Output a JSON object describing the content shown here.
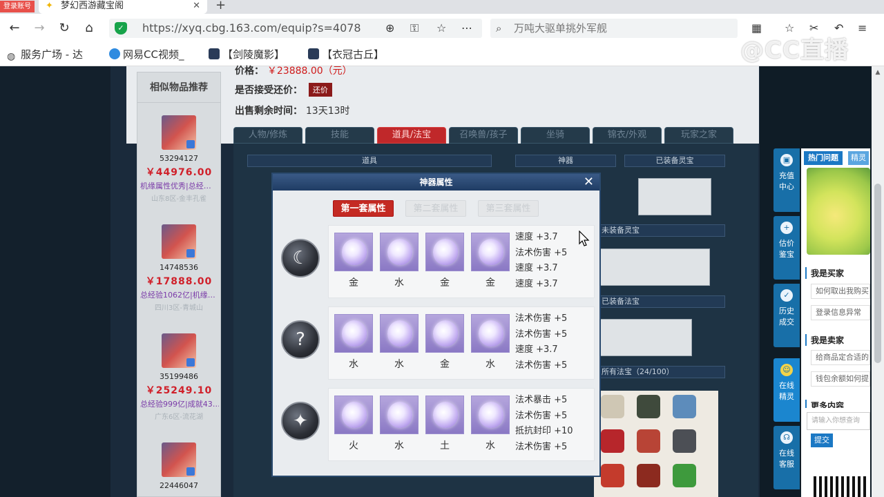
{
  "browser": {
    "login_badge": "登录账号",
    "tab_title": "梦幻西游藏宝阁",
    "tab_close": "✕",
    "new_tab": "+",
    "url": "https://xyq.cbg.163.com/equip?s=4078",
    "search_text": "万吨大驱单挑外军舰",
    "bookmarks": [
      "服务广场 - 达",
      "网易CC视频_",
      "【剑陵魔影】",
      "【衣冠古丘】"
    ]
  },
  "overlay": {
    "brand": "@CC直播"
  },
  "sidebar_left": {
    "title": "相似物品推荐",
    "items": [
      {
        "id": "53294127",
        "price": "￥44976.00",
        "desc": "机缘属性优秀|总经…",
        "server": "山东8区-金丰孔雀"
      },
      {
        "id": "14748536",
        "price": "￥17888.00",
        "desc": "总经验1062亿|机缘…",
        "server": "四川3区-青城山"
      },
      {
        "id": "35199486",
        "price": "￥25249.10",
        "desc": "总经验999亿|成就43…",
        "server": "广东6区-流花湖"
      },
      {
        "id": "22446047",
        "price": "",
        "desc": "",
        "server": ""
      }
    ]
  },
  "info": {
    "price_label": "价格：",
    "price_value": "￥23888.00（元）",
    "counter_label": "是否接受还价：",
    "counter_button": "还价",
    "time_label": "出售剩余时间：",
    "time_value": "13天13时"
  },
  "page_tabs": [
    "人物/修炼",
    "技能",
    "道具/法宝",
    "召唤兽/孩子",
    "坐骑",
    "锦衣/外观",
    "玩家之家"
  ],
  "sections": {
    "items": "道具",
    "relic": "神器",
    "equipped_lingbao": "已装备灵宝",
    "unequipped_lingbao": "未装备灵宝",
    "equipped_fabao": "已装备法宝",
    "all_fabao": "所有法宝（24/100）"
  },
  "dialog": {
    "title": "神器属性",
    "close": "✕",
    "set_tabs": [
      "第一套属性",
      "第二套属性",
      "第三套属性"
    ],
    "rows": [
      {
        "relic_glyph": "☾",
        "gems": [
          "金",
          "水",
          "金",
          "金"
        ],
        "attrs": [
          "速度 +3.7",
          "法术伤害 +5",
          "速度 +3.7",
          "速度 +3.7"
        ]
      },
      {
        "relic_glyph": "?",
        "gems": [
          "水",
          "水",
          "金",
          "水"
        ],
        "attrs": [
          "法术伤害 +5",
          "法术伤害 +5",
          "速度 +3.7",
          "法术伤害 +5"
        ]
      },
      {
        "relic_glyph": "✦",
        "gems": [
          "火",
          "水",
          "土",
          "水"
        ],
        "attrs": [
          "法术暴击 +5",
          "法术伤害 +5",
          "抵抗封印 +10",
          "法术伤害 +5"
        ]
      }
    ]
  },
  "right_tabs": [
    {
      "label1": "充值",
      "label2": "中心",
      "icon": "▣"
    },
    {
      "label1": "估价",
      "label2": "鉴宝",
      "icon": "+"
    },
    {
      "label1": "历史",
      "label2": "成交",
      "icon": "✓"
    },
    {
      "label1": "在线",
      "label2": "精灵",
      "icon": "☺"
    },
    {
      "label1": "在线",
      "label2": "客服",
      "icon": "☊"
    }
  ],
  "help": {
    "tab_hot": "热门问题",
    "tab_sprite": "精灵",
    "buyer_title": "我是买家",
    "buyer_links": [
      "如何取出我购买",
      "登录信息异常"
    ],
    "seller_title": "我是卖家",
    "seller_links": [
      "给商品定合适的",
      "钱包余额如何提"
    ],
    "more_title": "更多内容",
    "input_placeholder": "请输入你想查询",
    "submit": "提交"
  },
  "colors": {
    "accent_red": "#c42a23",
    "price_red": "#d0202a",
    "dialog_header": "#1f3c64",
    "help_blue": "#1b78c4"
  }
}
